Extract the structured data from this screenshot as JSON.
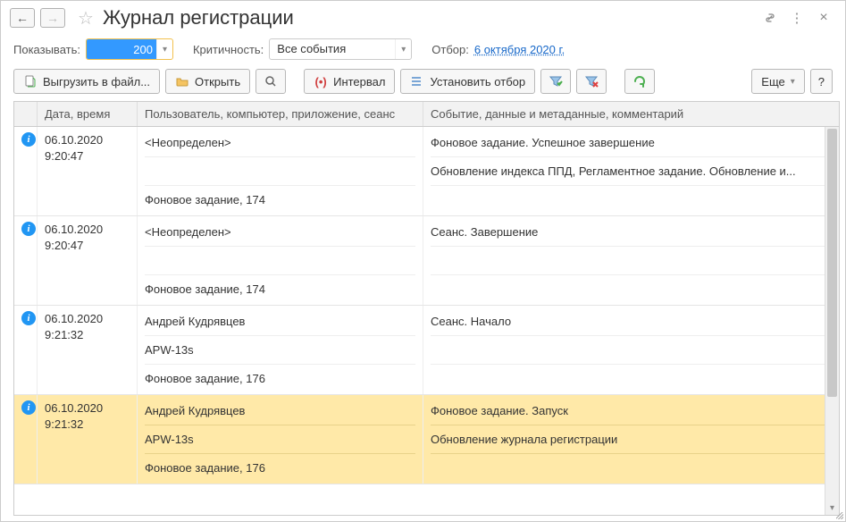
{
  "header": {
    "title": "Журнал регистрации"
  },
  "filter": {
    "show_label": "Показывать:",
    "show_value": "200",
    "criticality_label": "Критичность:",
    "criticality_value": "Все события",
    "selection_label": "Отбор:",
    "selection_link": "6 октября 2020 г."
  },
  "toolbar": {
    "export_label": "Выгрузить в файл...",
    "open_label": "Открыть",
    "interval_label": "Интервал",
    "set_filter_label": "Установить отбор",
    "more_label": "Еще",
    "help_label": "?"
  },
  "columns": {
    "date": "Дата, время",
    "user": "Пользователь, компьютер, приложение, сеанс",
    "event": "Событие, данные и метаданные, комментарий"
  },
  "rows": [
    {
      "date": "06.10.2020",
      "time": "9:20:47",
      "user_lines": [
        "<Неопределен>",
        "",
        "Фоновое задание, 174"
      ],
      "event_lines": [
        "Фоновое задание. Успешное завершение",
        "Обновление индекса ППД, Регламентное задание. Обновление и...",
        ""
      ],
      "selected": false
    },
    {
      "date": "06.10.2020",
      "time": "9:20:47",
      "user_lines": [
        "<Неопределен>",
        "",
        "Фоновое задание, 174"
      ],
      "event_lines": [
        "Сеанс. Завершение",
        "",
        ""
      ],
      "selected": false
    },
    {
      "date": "06.10.2020",
      "time": "9:21:32",
      "user_lines": [
        "Андрей Кудрявцев",
        "APW-13s",
        "Фоновое задание, 176"
      ],
      "event_lines": [
        "Сеанс. Начало",
        "",
        ""
      ],
      "selected": false
    },
    {
      "date": "06.10.2020",
      "time": "9:21:32",
      "user_lines": [
        "Андрей Кудрявцев",
        "APW-13s",
        "Фоновое задание, 176"
      ],
      "event_lines": [
        "Фоновое задание. Запуск",
        "Обновление журнала регистрации",
        ""
      ],
      "selected": true
    }
  ],
  "icons": {
    "back": "←",
    "forward": "→",
    "star": "☆",
    "link": "🔗",
    "kebab": "⋮",
    "close": "×",
    "dropdown": "▾"
  }
}
